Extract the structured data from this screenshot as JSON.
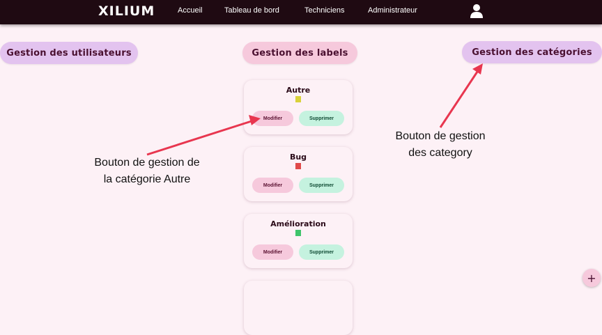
{
  "navbar": {
    "logo": "XILIUM",
    "links": [
      "Accueil",
      "Tableau de bord",
      "Techniciens",
      "Administrateur"
    ],
    "avatar_icon": "user-icon"
  },
  "sections": {
    "users": "Gestion des utilisateurs",
    "labels": "Gestion des labels",
    "categories": "Gestion des catégories"
  },
  "cards": [
    {
      "title": "Autre",
      "color": "#d9d23a",
      "edit": "Modifier",
      "delete": "Supprimer"
    },
    {
      "title": "Bug",
      "color": "#e04a4a",
      "edit": "Modifier",
      "delete": "Supprimer"
    },
    {
      "title": "Amélioration",
      "color": "#3fc46b",
      "edit": "Modifier",
      "delete": "Supprimer"
    }
  ],
  "annotations": {
    "left_line1": "Bouton de gestion de",
    "left_line2": "la catégorie Autre",
    "right_line1": "Bouton de gestion",
    "right_line2": "des category"
  },
  "fab_label": "+",
  "colors": {
    "navbar": "#1f0a12",
    "background": "#fdf1f6",
    "arrow": "#e8364f"
  }
}
